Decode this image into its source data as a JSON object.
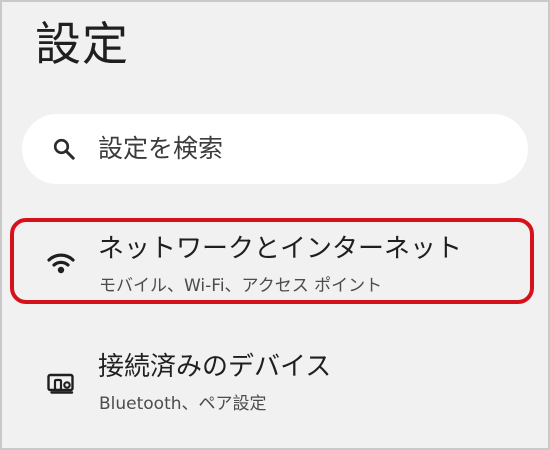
{
  "header": {
    "title": "設定"
  },
  "search": {
    "icon": "search-icon",
    "placeholder": "設定を検索"
  },
  "settings_items": [
    {
      "id": "network",
      "icon": "wifi-icon",
      "title": "ネットワークとインターネット",
      "subtitle": "モバイル、Wi-Fi、アクセス ポイント",
      "highlighted": true
    },
    {
      "id": "connected-devices",
      "icon": "devices-icon",
      "title": "接続済みのデバイス",
      "subtitle": "Bluetooth、ペア設定",
      "highlighted": false
    }
  ],
  "colors": {
    "background": "#f1f1f1",
    "border": "#c9c9c9",
    "search_background": "#ffffff",
    "text_primary": "#1f1f1f",
    "text_secondary": "#4c4c4c",
    "highlight": "#d7111b"
  }
}
